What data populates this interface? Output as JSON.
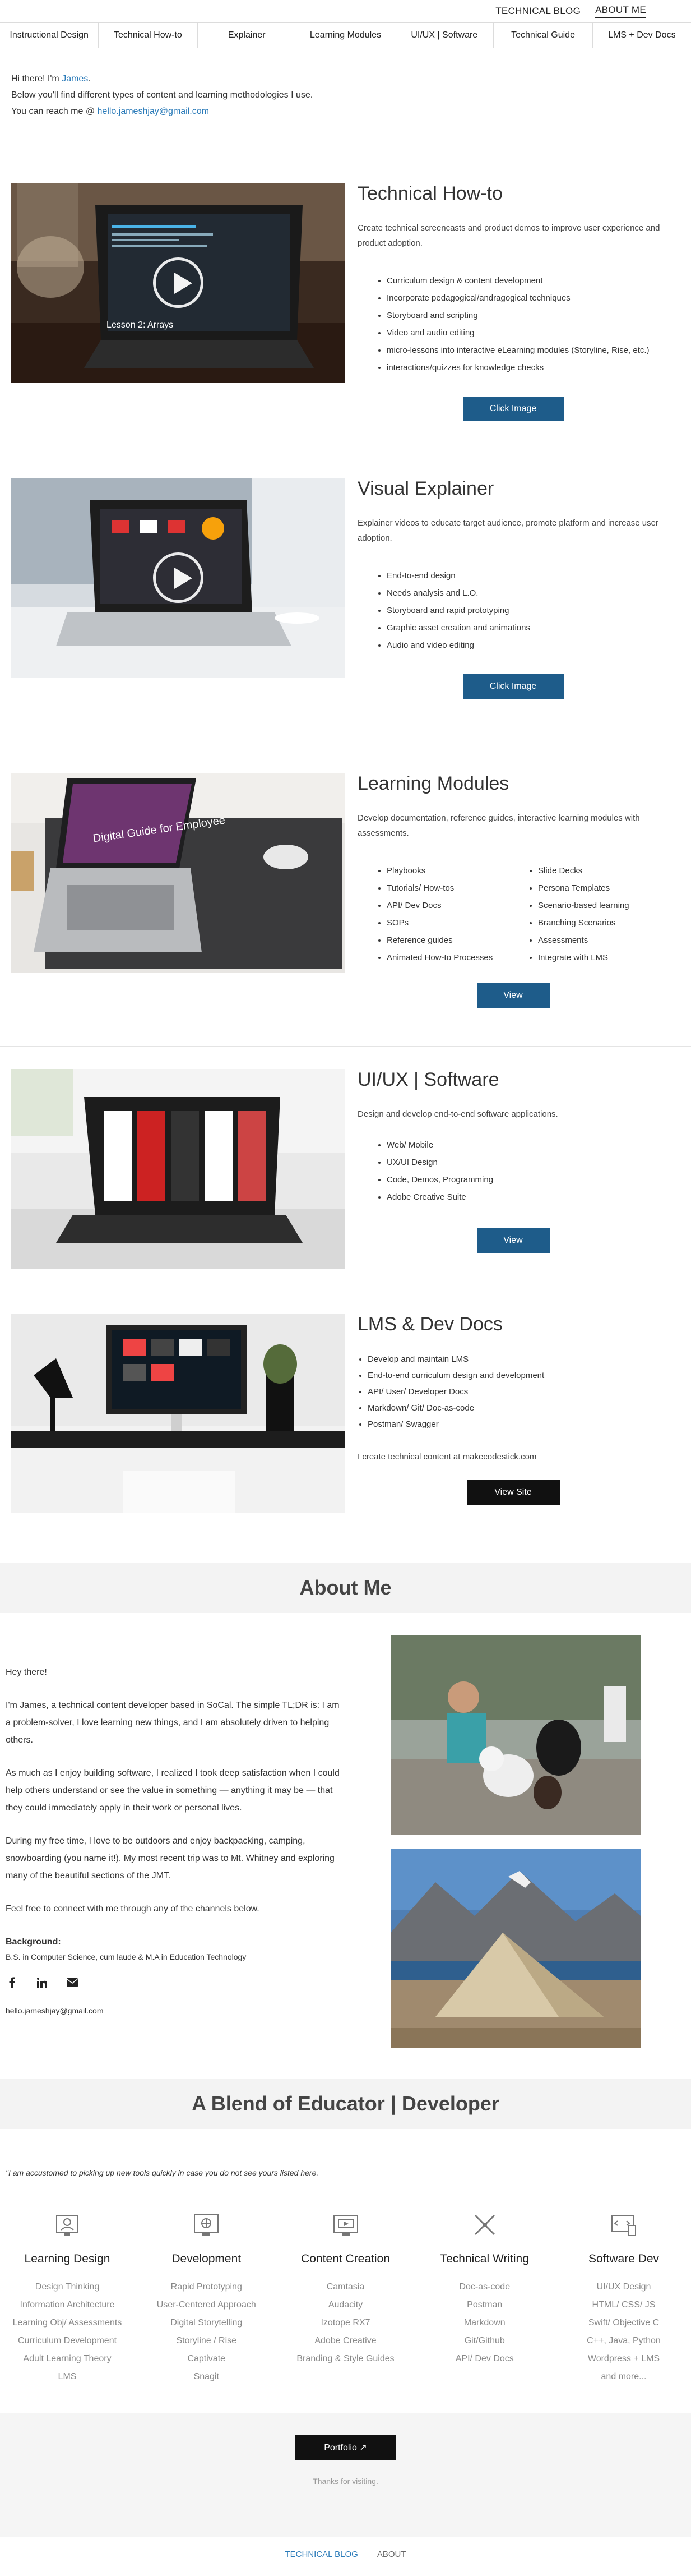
{
  "topnav": {
    "blog": "TECHNICAL BLOG",
    "about": "ABOUT ME"
  },
  "tabs": [
    "Instructional Design",
    "Technical How-to",
    "Explainer",
    "Learning Modules",
    "UI/UX | Software",
    "Technical Guide",
    "LMS + Dev Docs"
  ],
  "intro": {
    "line1_prefix": "Hi there! I'm ",
    "name": "James",
    "line1_suffix": ".",
    "line2": "Below you'll find different types of content and learning methodologies I use.",
    "line3_prefix": "You can reach me @ ",
    "email": "hello.jameshjay@gmail.com"
  },
  "sections": {
    "howto": {
      "title": "Technical How-to",
      "desc": "Create technical screencasts and product demos to improve user experience and product adoption.",
      "items": [
        "Curriculum design & content development",
        "Incorporate pedagogical/andragogical techniques",
        "Storyboard and scripting",
        "Video and audio editing",
        "micro-lessons into interactive eLearning modules  (Storyline, Rise, etc.)",
        "interactions/quizzes for knowledge checks"
      ],
      "button": "Click Image",
      "image_caption": "Lesson 2: Arrays"
    },
    "explainer": {
      "title": "Visual Explainer",
      "desc": "Explainer videos to educate target audience, promote platform and increase user adoption.",
      "items": [
        "End-to-end design",
        "Needs analysis and L.O.",
        "Storyboard and rapid prototyping",
        "Graphic asset creation and animations",
        "Audio and video editing"
      ],
      "button": "Click Image"
    },
    "modules": {
      "title": "Learning Modules",
      "desc": "Develop documentation, reference guides, interactive learning modules with assessments.",
      "items_left": [
        "Playbooks",
        "Tutorials/ How-tos",
        "API/ Dev Docs",
        "SOPs",
        "Reference guides",
        "Animated How-to Processes"
      ],
      "items_right": [
        "Slide Decks",
        "Persona Templates",
        "Scenario-based learning",
        "Branching Scenarios",
        "Assessments",
        "Integrate with LMS"
      ],
      "button": "View",
      "image_caption": "Digital Guide for Employee"
    },
    "uiux": {
      "title": "UI/UX | Software",
      "desc": "Design and develop end-to-end software applications.",
      "items": [
        "Web/ Mobile",
        "UX/UI Design",
        "Code, Demos, Programming",
        "Adobe Creative Suite"
      ],
      "button": "View"
    },
    "lms": {
      "title": "LMS & Dev Docs",
      "items": [
        "Develop and maintain LMS",
        "End-to-end curriculum design and development",
        "API/ User/ Developer Docs",
        "Markdown/ Git/ Doc-as-code",
        "Postman/ Swagger"
      ],
      "note": "I create technical content at makecodestick.com",
      "button": "View Site"
    }
  },
  "about": {
    "heading": "About Me",
    "greeting": "Hey there!",
    "p1": "I'm James, a technical content developer based in SoCal. The simple TL;DR is: I am a problem-solver, I love learning new things, and I am absolutely driven to helping others.",
    "p2": "As much as I enjoy building software, I realized I took deep satisfaction when I could help others understand or see the value in something — anything it may be — that they could immediately apply in their work or personal lives.",
    "p3": "During my free time, I love to be outdoors and enjoy backpacking, camping, snowboarding (you name it!). My most recent trip was to Mt. Whitney and exploring many of the beautiful sections of the JMT.",
    "p4": "Feel free to connect with me through any of the channels below.",
    "background_label": "Background:",
    "background": "B.S. in Computer Science, cum laude & M.A in Education Technology",
    "email": "hello.jameshjay@gmail.com"
  },
  "blend": {
    "heading": "A Blend of Educator | Developer",
    "note": "\"I am accustomed to picking up new tools quickly in case you do not see yours listed here.",
    "skills": [
      {
        "icon": "learning-design-icon",
        "title": "Learning Design",
        "lines": [
          "Design Thinking",
          "Information Architecture",
          "Learning Obj/ Assessments",
          "Curriculum Development",
          "Adult Learning Theory",
          "LMS"
        ]
      },
      {
        "icon": "development-icon",
        "title": "Development",
        "lines": [
          "Rapid Prototyping",
          "User-Centered Approach",
          "Digital Storytelling",
          "Storyline / Rise",
          "Captivate",
          "Snagit"
        ]
      },
      {
        "icon": "content-creation-icon",
        "title": "Content Creation",
        "lines": [
          "Camtasia",
          "Audacity",
          "Izotope RX7",
          "Adobe Creative",
          "Branding & Style Guides"
        ]
      },
      {
        "icon": "technical-writing-icon",
        "title": "Technical Writing",
        "lines": [
          "Doc-as-code",
          "Postman",
          "Markdown",
          "Git/Github",
          "API/ Dev Docs"
        ]
      },
      {
        "icon": "software-dev-icon",
        "title": "Software Dev",
        "lines": [
          "UI/UX Design",
          "HTML/ CSS/ JS",
          "Swift/ Objective C",
          "C++, Java, Python",
          "Wordpress + LMS",
          "and more..."
        ]
      }
    ]
  },
  "footer": {
    "portfolio": "Portfolio ↗",
    "thanks": "Thanks for visiting.",
    "nav_blog": "TECHNICAL BLOG",
    "nav_about": "ABOUT"
  },
  "colors": {
    "accent": "#1e5c8a",
    "link": "#2b7bb9",
    "dark_button": "#111111",
    "band": "#f3f3f3"
  }
}
